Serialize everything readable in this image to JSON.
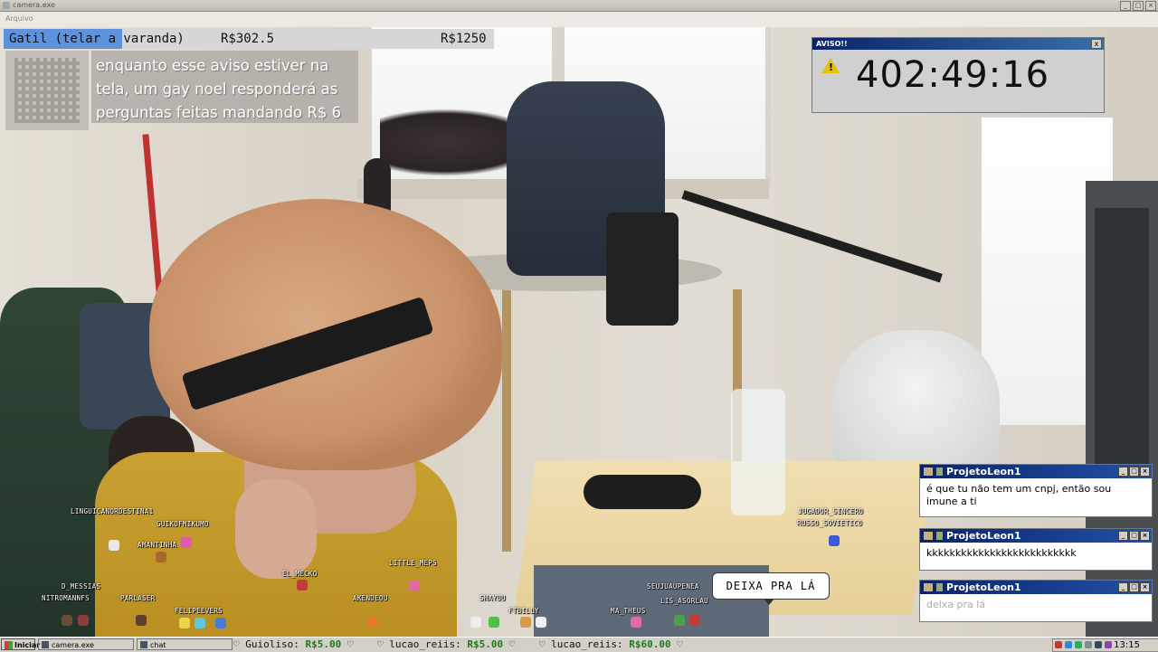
{
  "window": {
    "title": "camera.exe",
    "menu": "Arquivo"
  },
  "donation_goal": {
    "label": "Gatil (telar a varanda)",
    "current": "R$302.5",
    "target": "R$1250",
    "progress_fraction": 0.242
  },
  "notice": {
    "text": "enquanto esse aviso estiver na tela, um gay noel responderá as perguntas feitas mandando R$ 6"
  },
  "aviso": {
    "title": "AVISO!!",
    "timer": "402:49:16",
    "close": "x",
    "warning_glyph": "!"
  },
  "chat_popups": [
    {
      "user": "ProjetoLeon1",
      "message": "é que tu não tem um cnpj, então sou imune a ti",
      "faded": false
    },
    {
      "user": "ProjetoLeon1",
      "message": "kkkkkkkkkkkkkkkkkkkkkkkkkk",
      "faded": false
    },
    {
      "user": "ProjetoLeon1",
      "message": "delxa pra lá",
      "faded": true
    }
  ],
  "viewers": [
    "LINGUICANORDESTINA1",
    "GUIKOFMIKUMO",
    "AMANTINHA",
    "D_MESSIAS",
    "NITROMANNFS",
    "PARLASER",
    "FELIPEEVERS",
    "EL_MECKO",
    "LITTLE_MEPS",
    "AKENDEOU",
    "SHAYUU",
    "FTBILLY",
    "MA_THEUS",
    "SEUJUAUPENEA",
    "LIS_ASORLAU",
    "JUGADOR_SINCERO",
    "RUSSO_SOVIETICO"
  ],
  "speech_bubble": "DEIXA PRA LÁ",
  "taskbar": {
    "start": "Iniciar",
    "tasks": [
      "camera.exe",
      "chat"
    ],
    "ticker": [
      {
        "name": "Guioliso",
        "amount": "R$5.00"
      },
      {
        "name": "lucao_reiis",
        "amount": "R$5.00"
      },
      {
        "name": "lucao_reiis",
        "amount": "R$60.00"
      }
    ],
    "heart": "♡",
    "clock": "13:15",
    "tray_colors": [
      "#c0392b",
      "#2e86de",
      "#27ae60",
      "#7f8c8d",
      "#34495e",
      "#8e44ad"
    ]
  },
  "colors": {
    "progress": "#5f91dc",
    "title_bar": "#0a246a",
    "donation_amount": "#1c7a1c"
  }
}
